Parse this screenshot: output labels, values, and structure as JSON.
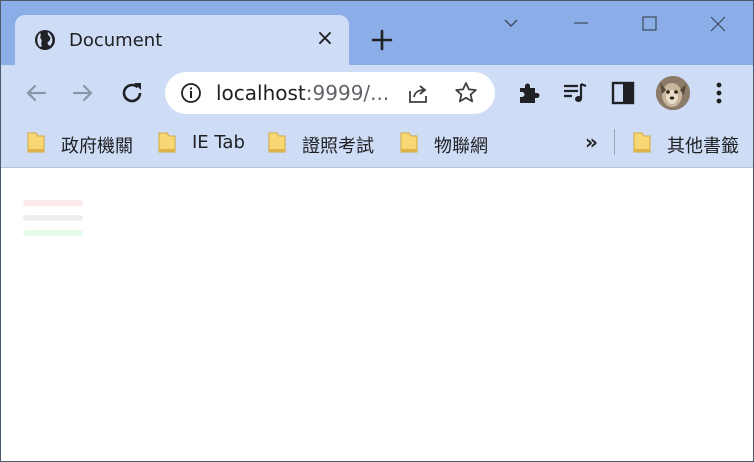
{
  "browser": {
    "tab": {
      "title": "Document",
      "icon": "globe-icon",
      "close_label": "×"
    },
    "new_tab_icon": "plus-icon",
    "window_controls": [
      "chevron-down-icon",
      "minimize-icon",
      "maximize-icon",
      "close-icon"
    ],
    "url": {
      "host": "localhost",
      "rest": ":9999/..."
    },
    "toolbar_icons": [
      "extensions-icon",
      "reading-list-icon",
      "side-panel-icon",
      "avatar",
      "menu-icon"
    ]
  },
  "bookmarks": {
    "items": [
      {
        "label": "政府機關"
      },
      {
        "label": "IE Tab"
      },
      {
        "label": "證照考試"
      },
      {
        "label": "物聯網"
      }
    ],
    "more_label": "»",
    "other_label": "其他書籤"
  },
  "page": {
    "placeholder_colors": [
      "#fde8ea",
      "#eeeeee",
      "#e6fbe8"
    ]
  }
}
